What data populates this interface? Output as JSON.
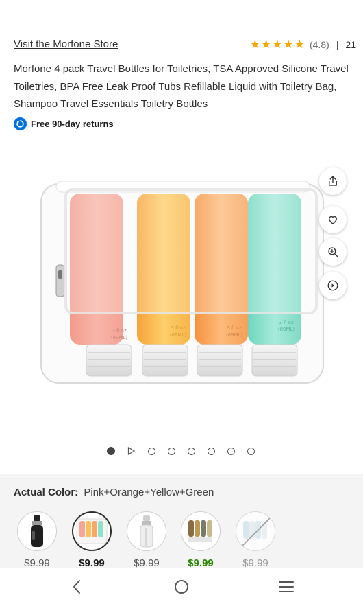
{
  "store": {
    "link_label": "Visit the Morfone Store",
    "rating_value": "(4.8)",
    "separator": "|",
    "review_count": "21",
    "star_color": "#f6a600"
  },
  "product": {
    "title": "Morfone 4 pack Travel Bottles for Toiletries, TSA Approved Silicone Travel Toiletries, BPA Free Leak Proof Tubs Refillable Liquid with Toiletry Bag, Shampoo Travel Essentials Toiletry Bottles",
    "returns": "Free 90-day returns",
    "image_description_icon": "product-image",
    "bottle_labels": [
      "3 fl oz",
      "(89ML)"
    ]
  },
  "image_actions": [
    "share-icon",
    "heart-icon",
    "zoom-in-icon",
    "play-circle-icon"
  ],
  "carousel": {
    "total": 8,
    "active_index": 0
  },
  "variants": {
    "label": "Actual Color:",
    "selected_value": "Pink+Orange+Yellow+Green",
    "options": [
      {
        "price": "$9.99",
        "kind": "black-spray"
      },
      {
        "price": "$9.99",
        "kind": "pink-orange-yellow-green",
        "selected": true
      },
      {
        "price": "$9.99",
        "kind": "clear-spray"
      },
      {
        "price": "$9.99",
        "kind": "earth-tones",
        "deal": true
      },
      {
        "price": "$9.99",
        "kind": "pastel-unavailable",
        "unavailable": true
      }
    ]
  },
  "colors": {
    "accent_blue": "#0071dc",
    "deal_green": "#2a8703",
    "panel_bg": "#f4f4f5"
  },
  "nav": [
    "back-icon",
    "home-icon",
    "menu-icon"
  ]
}
